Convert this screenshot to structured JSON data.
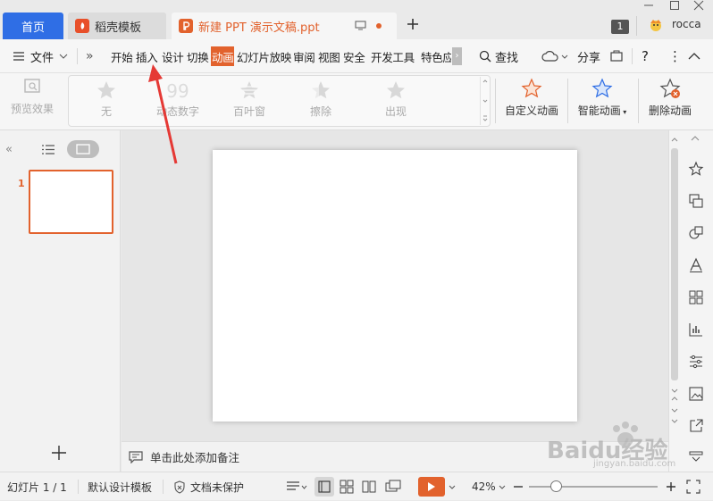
{
  "tabs": {
    "home": "首页",
    "template": "稻壳模板",
    "document": "新建 PPT 演示文稿.ppt"
  },
  "window": {
    "page_badge": "1",
    "user_name": "rocca"
  },
  "toolbar": {
    "file_label": "文件",
    "menu_tabs": [
      "开始",
      "插入",
      "设计",
      "切换",
      "动画",
      "幻灯片放映",
      "审阅",
      "视图",
      "安全",
      "开发工具",
      "特色应"
    ],
    "active_tab": "动画",
    "search_label": "查找",
    "share_label": "分享"
  },
  "ribbon": {
    "preview_label": "预览效果",
    "effects": [
      "无",
      "动态数字",
      "百叶窗",
      "擦除",
      "出现"
    ],
    "custom_animation": "自定义动画",
    "smart_animation": "智能动画",
    "delete_animation": "删除动画"
  },
  "slides_panel": {
    "slide_number": "1"
  },
  "notes": {
    "placeholder": "单击此处添加备注"
  },
  "status": {
    "slide_info": "幻灯片 1 / 1",
    "design_template": "默认设计模板",
    "protection": "文档未保护",
    "zoom": "42%"
  },
  "watermark": {
    "text": "Baidu经验",
    "subtext": "jingyan.baidu.com"
  },
  "colors": {
    "accent": "#e2622d",
    "home_tab": "#2f6ee5",
    "arrow": "#e53935"
  }
}
